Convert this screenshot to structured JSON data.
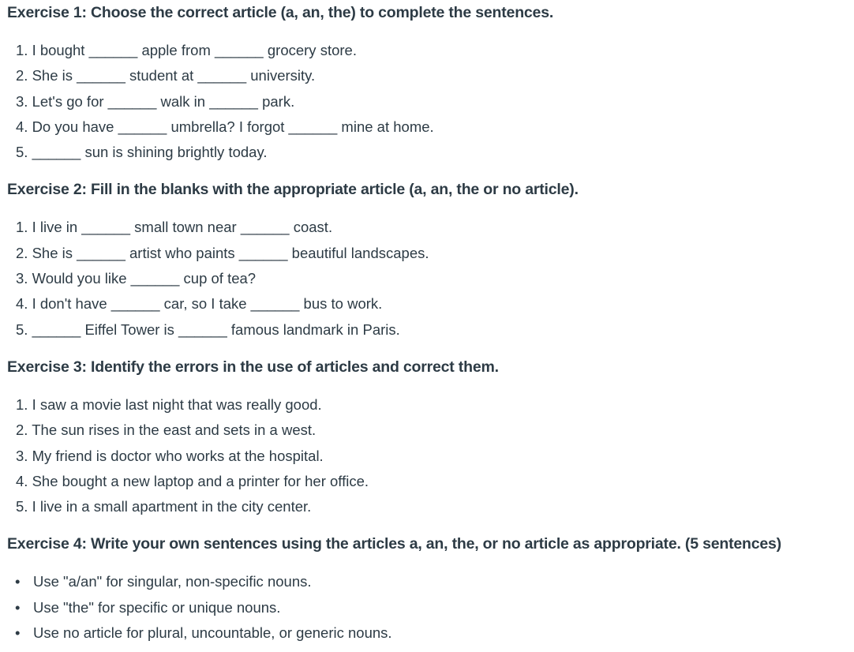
{
  "exercises": [
    {
      "title": "Exercise 1: Choose the correct article (a, an, the) to complete the sentences.",
      "items": [
        "1. I bought ______ apple from ______ grocery store.",
        "2. She is ______ student at ______ university.",
        "3. Let's go for ______ walk in ______ park.",
        "4. Do you have ______ umbrella? I forgot ______ mine at home.",
        "5. ______ sun is shining brightly today."
      ]
    },
    {
      "title": "Exercise 2: Fill in the blanks with the appropriate article (a, an, the or no article).",
      "items": [
        "1. I live in ______ small town near ______ coast.",
        "2. She is ______ artist who paints ______ beautiful landscapes.",
        "3. Would you like ______ cup of tea?",
        "4. I don't have ______ car, so I take ______ bus to work.",
        "5. ______ Eiffel Tower is ______ famous landmark in Paris."
      ]
    },
    {
      "title": "Exercise 3: Identify the errors in the use of articles and correct them.",
      "items": [
        "1. I saw a movie last night that was really good.",
        "2. The sun rises in the east and sets in a west.",
        "3. My friend is doctor who works at the hospital.",
        "4. She bought a new laptop and a printer for her office.",
        "5. I live in a small apartment in the city center."
      ]
    },
    {
      "title": "Exercise 4: Write your own sentences using the articles a, an, the, or no article as appropriate. (5 sentences)",
      "bullets": [
        "Use \"a/an\" for singular, non-specific nouns.",
        "Use \"the\" for specific or unique nouns.",
        "Use no article for plural, uncountable, or generic nouns."
      ]
    }
  ],
  "bullet_icon": "•"
}
